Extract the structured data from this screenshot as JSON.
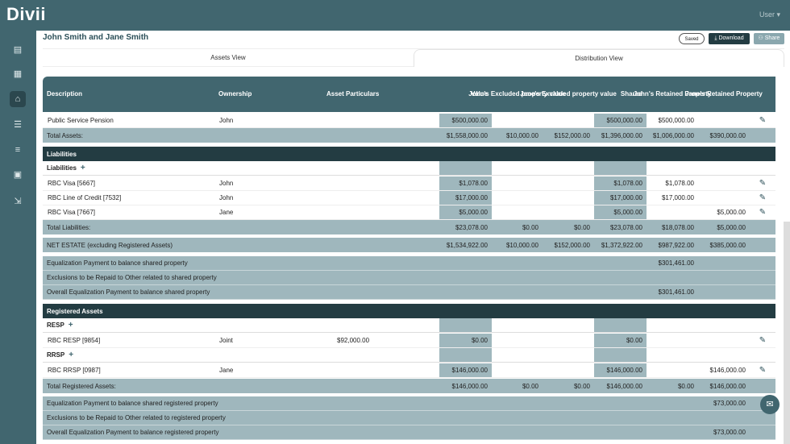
{
  "app": {
    "logo": "Divii",
    "user": "User"
  },
  "page": {
    "title": "John Smith and Jane Smith",
    "saved": "Saved",
    "download": "Download",
    "share": "Share"
  },
  "tabs": [
    "Assets View",
    "Distribution View"
  ],
  "columns": [
    "Description",
    "Ownership",
    "Asset Particulars",
    "Value",
    "John's Excluded property value",
    "Jane's Excluded property value",
    "Shared",
    "John's Retained Property",
    "Jane's Retained Property"
  ],
  "rows": [
    {
      "type": "item",
      "cells": [
        "Public Service Pension",
        "John",
        "",
        "$500,000.00",
        "",
        "",
        "$500,000.00",
        "$500,000.00",
        ""
      ],
      "edit": true
    },
    {
      "type": "total",
      "cells": [
        "Total Assets:",
        "",
        "",
        "$1,558,000.00",
        "$10,000.00",
        "$152,000.00",
        "$1,396,000.00",
        "$1,006,000.00",
        "$390,000.00"
      ]
    },
    {
      "type": "section",
      "cells": [
        "Liabilities"
      ]
    },
    {
      "type": "group",
      "cells": [
        "Liabilities"
      ]
    },
    {
      "type": "item",
      "cells": [
        "RBC Visa [5667]",
        "John",
        "",
        "$1,078.00",
        "",
        "",
        "$1,078.00",
        "$1,078.00",
        ""
      ],
      "edit": true
    },
    {
      "type": "item",
      "cells": [
        "RBC Line of Credit [7532]",
        "John",
        "",
        "$17,000.00",
        "",
        "",
        "$17,000.00",
        "$17,000.00",
        ""
      ],
      "edit": true
    },
    {
      "type": "item",
      "cells": [
        "RBC Visa [7667]",
        "Jane",
        "",
        "$5,000.00",
        "",
        "",
        "$5,000.00",
        "",
        "$5,000.00"
      ],
      "edit": true
    },
    {
      "type": "total",
      "cells": [
        "Total Liabilities:",
        "",
        "",
        "$23,078.00",
        "$0.00",
        "$0.00",
        "$23,078.00",
        "$18,078.00",
        "$5,000.00"
      ]
    },
    {
      "type": "net",
      "cells": [
        "NET ESTATE (excluding Registered Assets)",
        "",
        "",
        "$1,534,922.00",
        "$10,000.00",
        "$152,000.00",
        "$1,372,922.00",
        "$987,922.00",
        "$385,000.00"
      ]
    },
    {
      "type": "eq",
      "cells": [
        "Equalization Payment to balance shared property",
        "",
        "",
        "",
        "",
        "",
        "",
        "$301,461.00",
        ""
      ]
    },
    {
      "type": "eq",
      "cells": [
        "Exclusions to be Repaid to Other related to shared property",
        "",
        "",
        "",
        "",
        "",
        "",
        "",
        ""
      ]
    },
    {
      "type": "eq",
      "cells": [
        "Overall Equalization Payment to balance shared property",
        "",
        "",
        "",
        "",
        "",
        "",
        "$301,461.00",
        ""
      ]
    },
    {
      "type": "section",
      "cells": [
        "Registered Assets"
      ]
    },
    {
      "type": "group",
      "cells": [
        "RESP"
      ]
    },
    {
      "type": "item",
      "cells": [
        "RBC RESP [9854]",
        "Joint",
        "$92,000.00",
        "$0.00",
        "",
        "",
        "$0.00",
        "",
        ""
      ],
      "edit": true
    },
    {
      "type": "group",
      "cells": [
        "RRSP"
      ]
    },
    {
      "type": "item",
      "cells": [
        "RBC RRSP [0987]",
        "Jane",
        "",
        "$146,000.00",
        "",
        "",
        "$146,000.00",
        "",
        "$146,000.00"
      ],
      "edit": true
    },
    {
      "type": "total",
      "cells": [
        "Total Registered Assets:",
        "",
        "",
        "$146,000.00",
        "$0.00",
        "$0.00",
        "$146,000.00",
        "$0.00",
        "$146,000.00"
      ]
    },
    {
      "type": "eq",
      "cells": [
        "Equalization Payment to balance shared registered property",
        "",
        "",
        "",
        "",
        "",
        "",
        "",
        "$73,000.00"
      ]
    },
    {
      "type": "eq",
      "cells": [
        "Exclusions to be Repaid to Other related to registered property",
        "",
        "",
        "",
        "",
        "",
        "",
        "",
        ""
      ]
    },
    {
      "type": "eq",
      "cells": [
        "Overall Equalization Payment to balance registered property",
        "",
        "",
        "",
        "",
        "",
        "",
        "",
        "$73,000.00"
      ]
    }
  ]
}
